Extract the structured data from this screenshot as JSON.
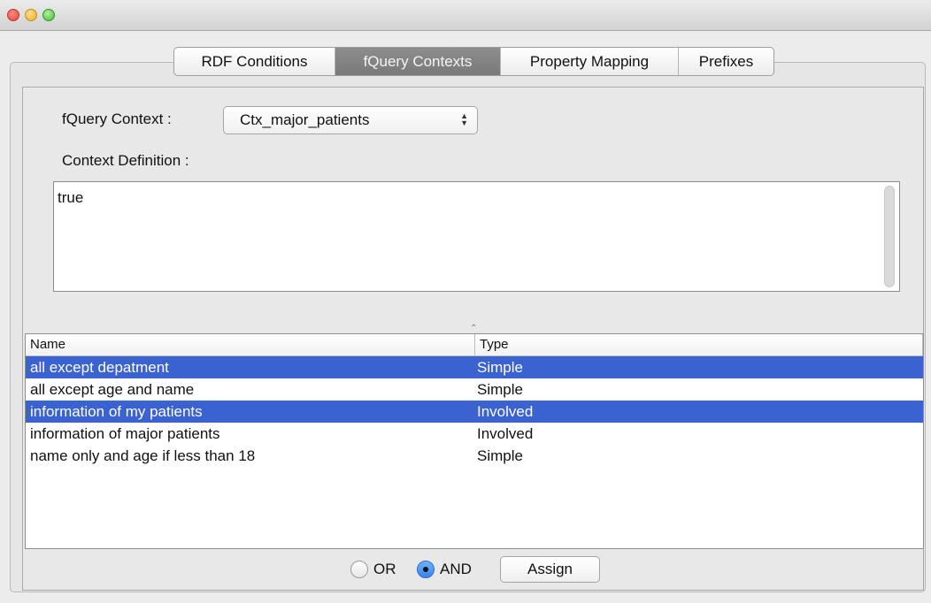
{
  "tabs": [
    {
      "label": "RDF Conditions",
      "active": false
    },
    {
      "label": "fQuery Contexts",
      "active": true
    },
    {
      "label": "Property Mapping",
      "active": false
    },
    {
      "label": "Prefixes",
      "active": false
    }
  ],
  "context_label": "fQuery Context :",
  "context_select": {
    "value": "Ctx_major_patients",
    "icon": "updown-arrows-icon"
  },
  "definition_label": "Context Definition :",
  "definition_text": "true",
  "table": {
    "columns": [
      "Name",
      "Type"
    ],
    "rows": [
      {
        "name": "all except depatment",
        "type": "Simple",
        "selected": true
      },
      {
        "name": "all except age and name",
        "type": "Simple",
        "selected": false
      },
      {
        "name": "information of my patients",
        "type": "Involved",
        "selected": true
      },
      {
        "name": "information of major patients",
        "type": "Involved",
        "selected": false
      },
      {
        "name": "name only and age if less than 18",
        "type": "Simple",
        "selected": false
      }
    ]
  },
  "options": {
    "or_label": "OR",
    "and_label": "AND",
    "selected": "AND"
  },
  "assign_label": "Assign",
  "colors": {
    "selection": "#3b62d1",
    "tab_active": "#808080"
  }
}
